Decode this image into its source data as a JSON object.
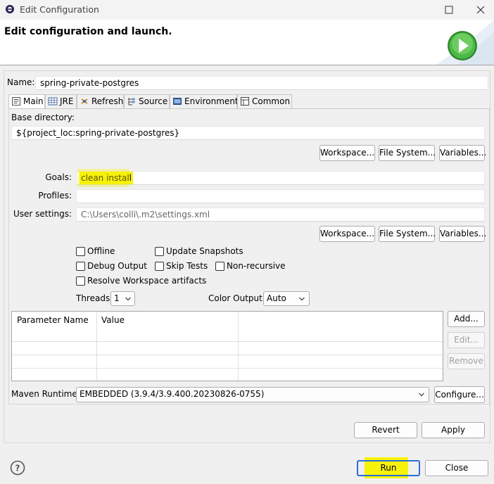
{
  "window": {
    "title": "Edit Configuration"
  },
  "header": {
    "title": "Edit configuration and launch."
  },
  "name": {
    "label": "Name:",
    "value": "spring-private-postgres"
  },
  "tabs": [
    {
      "label": "Main",
      "icon": "main-tab-icon"
    },
    {
      "label": "JRE",
      "icon": "jre-icon"
    },
    {
      "label": "Refresh",
      "icon": "refresh-icon"
    },
    {
      "label": "Source",
      "icon": "source-icon"
    },
    {
      "label": "Environment",
      "icon": "environment-icon"
    },
    {
      "label": "Common",
      "icon": "common-icon"
    }
  ],
  "main": {
    "base_dir_label": "Base directory:",
    "base_dir_value": "${project_loc:spring-private-postgres}",
    "base_buttons": {
      "workspace": "Workspace...",
      "filesystem": "File System...",
      "variables": "Variables..."
    },
    "goals_label": "Goals:",
    "goals_value": "clean install",
    "profiles_label": "Profiles:",
    "profiles_value": "",
    "user_settings_label": "User settings:",
    "user_settings_value": "C:\\Users\\colli\\.m2\\settings.xml",
    "settings_buttons": {
      "workspace": "Workspace...",
      "filesystem": "File System...",
      "variables": "Variables..."
    },
    "checkboxes": {
      "offline": "Offline",
      "update_snapshots": "Update Snapshots",
      "debug_output": "Debug Output",
      "skip_tests": "Skip Tests",
      "non_recursive": "Non-recursive",
      "resolve_workspace": "Resolve Workspace artifacts"
    },
    "threads_label": "Threads:",
    "threads_value": "1",
    "color_output_label": "Color Output:",
    "color_output_value": "Auto",
    "params_table": {
      "columns": [
        "Parameter Name",
        "Value"
      ],
      "rows": []
    },
    "param_buttons": {
      "add": "Add...",
      "edit": "Edit...",
      "remove": "Remove"
    },
    "maven_runtime_label": "Maven Runtime:",
    "maven_runtime_value": "EMBEDDED (3.9.4/3.9.400.20230826-0755)",
    "configure_label": "Configure..."
  },
  "footer": {
    "revert": "Revert",
    "apply": "Apply",
    "run": "Run",
    "close": "Close",
    "help_icon": "help-icon"
  },
  "colors": {
    "highlight": "#f7f20a",
    "run_button_border": "#2b6fd6",
    "run_icon": "#3aa236"
  }
}
